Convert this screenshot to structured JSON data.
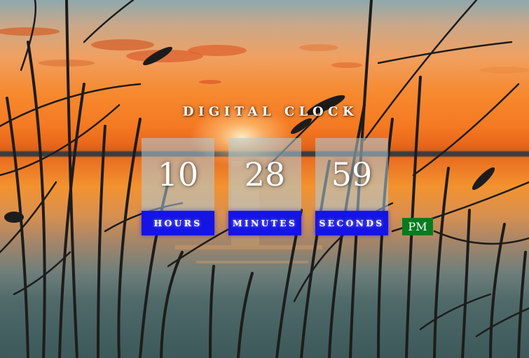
{
  "clock": {
    "title": "DIGITAL CLOCK",
    "hours": "10",
    "minutes": "28",
    "seconds": "59",
    "hours_label": "HOURS",
    "minutes_label": "MINUTES",
    "seconds_label": "SECONDS",
    "period": "PM"
  },
  "background": {
    "description_icon": "sunset-lake-grass-photo"
  },
  "colors": {
    "label_background": "#1414e6",
    "ampm_background": "#0a7a1f",
    "digit_box_background": "rgba(175,205,220,0.55)",
    "text": "#ffffff"
  }
}
